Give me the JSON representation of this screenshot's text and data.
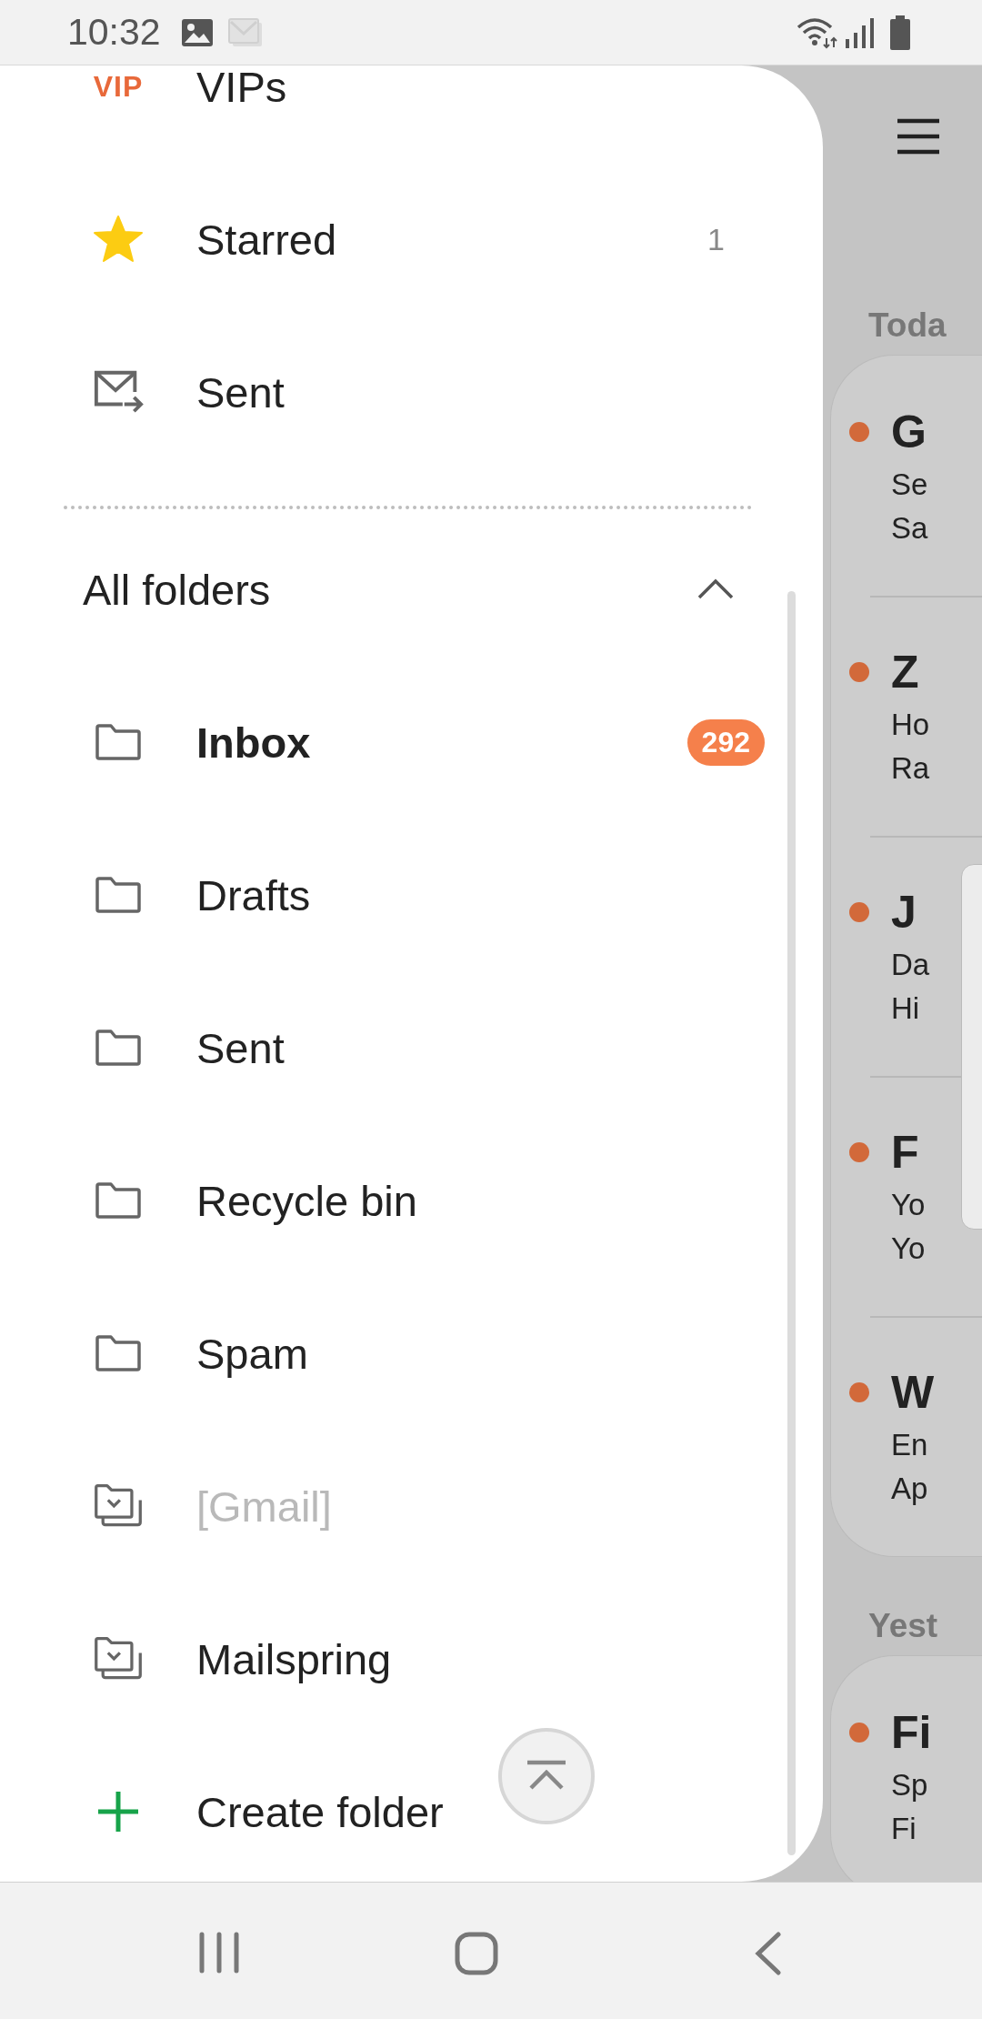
{
  "status_bar": {
    "time": "10:32"
  },
  "drawer": {
    "items": [
      {
        "kind": "vip",
        "icon_text": "VIP",
        "label": "VIPs"
      },
      {
        "kind": "starred",
        "label": "Starred",
        "count": "1"
      },
      {
        "kind": "sent",
        "label": "Sent"
      }
    ],
    "all_folders": {
      "title": "All folders",
      "expanded": true
    },
    "folders": [
      {
        "kind": "folder",
        "label": "Inbox",
        "badge": "292",
        "unread": true,
        "disabled": false
      },
      {
        "kind": "folder",
        "label": "Drafts",
        "unread": false,
        "disabled": false
      },
      {
        "kind": "folder",
        "label": "Sent",
        "unread": false,
        "disabled": false
      },
      {
        "kind": "folder",
        "label": "Recycle bin",
        "unread": false,
        "disabled": false
      },
      {
        "kind": "folder",
        "label": "Spam",
        "unread": false,
        "disabled": false
      },
      {
        "kind": "account",
        "label": "[Gmail]",
        "unread": false,
        "disabled": true
      },
      {
        "kind": "account",
        "label": "Mailspring",
        "unread": false,
        "disabled": false
      }
    ],
    "create_folder": {
      "label": "Create folder"
    }
  },
  "mail_list": {
    "sections": [
      {
        "heading": "Toda",
        "emails": [
          {
            "sender": "G",
            "subject": "Se",
            "preview": "Sa",
            "unread": true
          },
          {
            "sender": "Z",
            "subject": "Ho",
            "preview": "Ra",
            "unread": true
          },
          {
            "sender": "J",
            "subject": "Da",
            "preview": "Hi",
            "unread": true
          },
          {
            "sender": "F",
            "subject": "Yo",
            "preview": "Yo",
            "unread": true
          },
          {
            "sender": "W",
            "subject": "En",
            "preview": "Ap",
            "unread": true
          }
        ]
      },
      {
        "heading": "Yest",
        "emails": [
          {
            "sender": "Fi",
            "subject": "Sp",
            "preview": "Fi",
            "unread": true
          }
        ]
      }
    ]
  }
}
